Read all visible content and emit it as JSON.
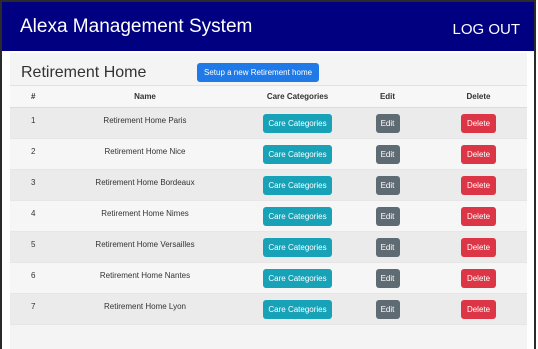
{
  "header": {
    "title": "Alexa Management System",
    "logout_label": "LOG OUT",
    "background": "#000080"
  },
  "page": {
    "title": "Retirement Home",
    "setup_label": "Setup a new Retirement home"
  },
  "table": {
    "columns": [
      "#",
      "Name",
      "Care Categories",
      "Edit",
      "Delete"
    ],
    "rows": [
      {
        "id": "1",
        "name": "Retirement Home Paris"
      },
      {
        "id": "2",
        "name": "Retirement Home Nice"
      },
      {
        "id": "3",
        "name": "Retirement Home Bordeaux"
      },
      {
        "id": "4",
        "name": "Retirement Home Nimes"
      },
      {
        "id": "5",
        "name": "Retirement Home Versailles"
      },
      {
        "id": "6",
        "name": "Retirement Home Nantes"
      },
      {
        "id": "7",
        "name": "Retirement Home Lyon"
      }
    ],
    "care_label": "Care Categories",
    "edit_label": "Edit",
    "delete_label": "Delete"
  },
  "colors": {
    "care": "#17a2b8",
    "edit": "#5f6b73",
    "delete": "#dc3545",
    "primary": "#1f7ae8"
  }
}
